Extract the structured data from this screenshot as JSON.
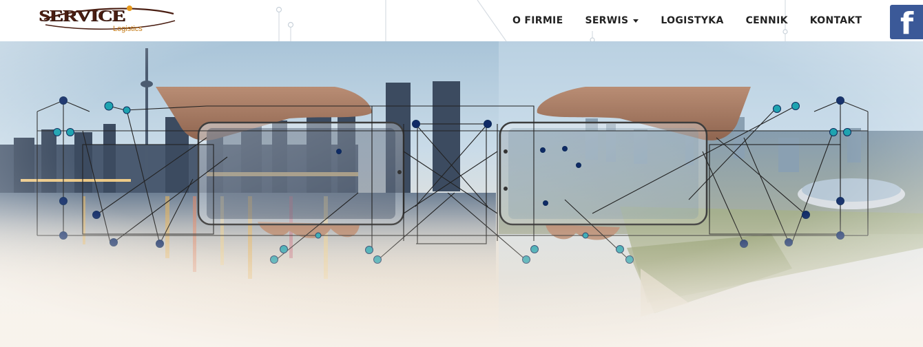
{
  "brand": {
    "name": "SERVICE",
    "tagline": "Logistics",
    "colors": {
      "wordmark": "#4a1e12",
      "accent": "#c57a14"
    }
  },
  "nav": {
    "items": [
      {
        "label": "O FIRMIE",
        "has_dropdown": false
      },
      {
        "label": "SERWIS",
        "has_dropdown": true
      },
      {
        "label": "LOGISTYKA",
        "has_dropdown": false
      },
      {
        "label": "CENNIK",
        "has_dropdown": false
      },
      {
        "label": "KONTAKT",
        "has_dropdown": false
      }
    ]
  },
  "social": {
    "icon": "facebook-icon",
    "glyph": "f",
    "color": "#3b5998"
  },
  "hero": {
    "image": "two hands holding smartphones over city skyline with network circuit overlay",
    "palette": {
      "sky": "#b9d3e6",
      "network_line": "#222222",
      "node_teal": "#1ea3b0",
      "node_navy": "#0f2a66"
    }
  }
}
